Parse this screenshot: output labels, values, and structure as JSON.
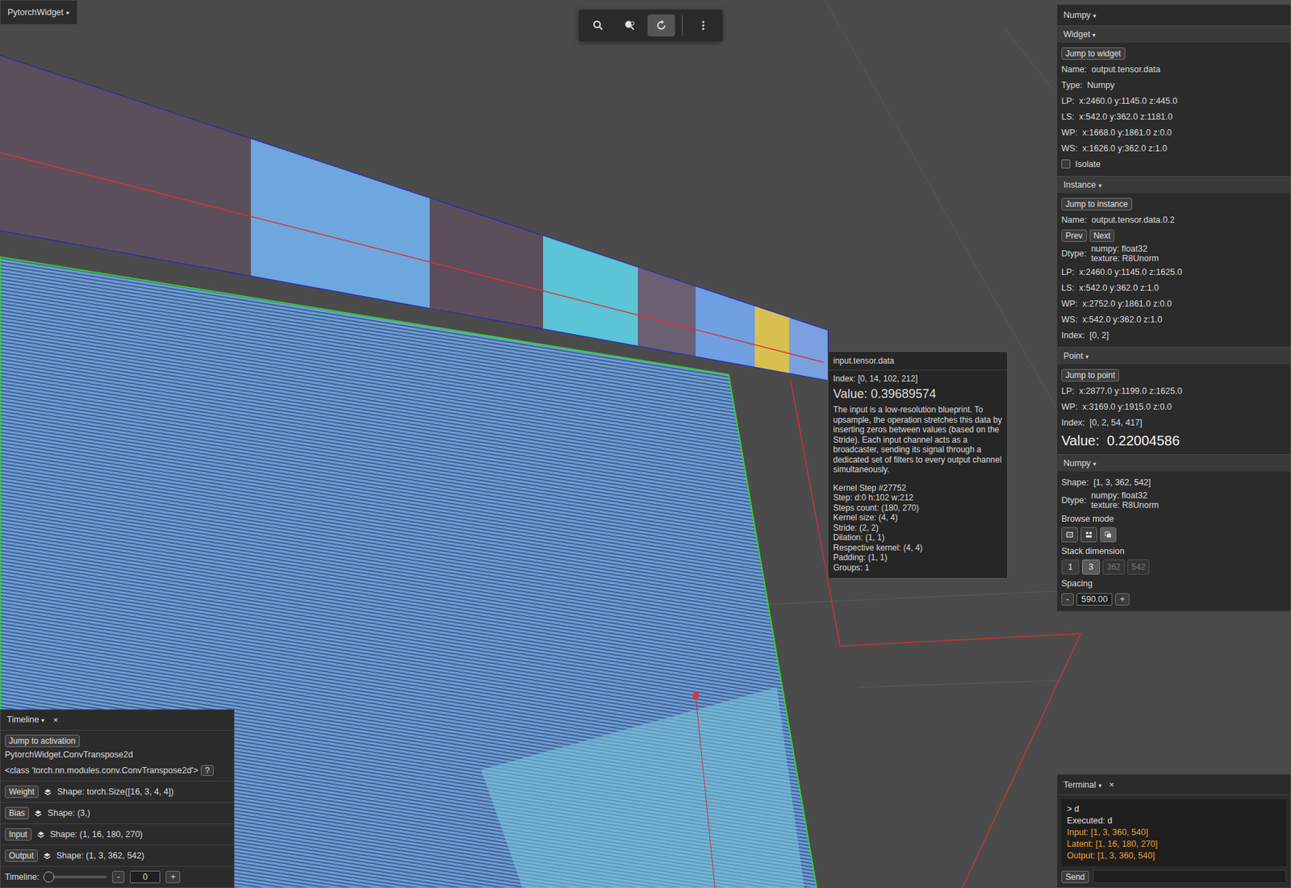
{
  "badge": {
    "label": "PytorchWidget",
    "caret": "▸"
  },
  "toolbar": {
    "tools": [
      {
        "kind": "search",
        "selected": false
      },
      {
        "kind": "zoom-pin",
        "selected": false
      },
      {
        "kind": "rotate",
        "selected": true
      },
      {
        "kind": "more",
        "selected": false
      }
    ]
  },
  "inspector": {
    "title": "Numpy",
    "caret": "▾",
    "widget": {
      "title": "Widget",
      "caret": "▾",
      "button": "Jump to widget",
      "fields": [
        {
          "label": "Name:",
          "value": [
            "output.tensor.data"
          ]
        },
        {
          "label": "Type:",
          "value": [
            "Numpy"
          ]
        },
        {
          "label": "LP:",
          "value": [
            "x:2460.0 y:1145.0 z:445.0"
          ]
        },
        {
          "label": "LS:",
          "value": [
            "x:542.0 y:362.0 z:1181.0"
          ]
        },
        {
          "label": "WP:",
          "value": [
            "x:1668.0 y:1861.0 z:0.0"
          ]
        },
        {
          "label": "WS:",
          "value": [
            "x:1626.0 y:362.0 z:1.0"
          ]
        }
      ],
      "isolate": {
        "label": "Isolate",
        "checked": false
      }
    },
    "instance": {
      "title": "Instance",
      "caret": "▾",
      "button": "Jump to instance",
      "name": {
        "label": "Name:",
        "value": [
          "output.tensor.data.0.2"
        ]
      },
      "nav": [
        "Prev",
        "Next"
      ],
      "fields": [
        {
          "label": "Dtype:",
          "value": [
            "numpy: float32",
            "texture: R8Unorm"
          ]
        },
        {
          "label": "LP:",
          "value": [
            "x:2460.0 y:1145.0 z:1625.0"
          ]
        },
        {
          "label": "LS:",
          "value": [
            "x:542.0 y:362.0 z:1.0"
          ]
        },
        {
          "label": "WP:",
          "value": [
            "x:2752.0 y:1861.0 z:0.0"
          ]
        },
        {
          "label": "WS:",
          "value": [
            "x:542.0 y:362.0 z:1.0"
          ]
        },
        {
          "label": "Index:",
          "value": [
            "[0, 2]"
          ]
        }
      ]
    },
    "point": {
      "title": "Point",
      "caret": "▾",
      "button": "Jump to point",
      "fields": [
        {
          "label": "LP:",
          "value": [
            "x:2877.0 y:1199.0 z:1625.0"
          ]
        },
        {
          "label": "WP:",
          "value": [
            "x:3169.0 y:1915.0 z:0.0"
          ]
        },
        {
          "label": "Index:",
          "value": [
            "[0, 2, 54, 417]"
          ]
        }
      ],
      "value": {
        "label": "Value:",
        "value": "0.22004586"
      }
    },
    "numpy": {
      "title": "Numpy",
      "caret": "▾",
      "fields": [
        {
          "label": "Shape:",
          "value": [
            "[1, 3, 362, 542]"
          ]
        },
        {
          "label": "Dtype:",
          "value": [
            "numpy: float32",
            "texture: R8Unorm"
          ]
        }
      ],
      "browse": {
        "label": "Browse mode",
        "modes": [
          {
            "kind": "list",
            "selected": false
          },
          {
            "kind": "grid",
            "selected": false
          },
          {
            "kind": "stack",
            "selected": true
          }
        ]
      },
      "stack": {
        "label": "Stack dimension",
        "options": [
          {
            "label": "1",
            "selected": false,
            "disabled": false
          },
          {
            "label": "3",
            "selected": true,
            "disabled": false
          },
          {
            "label": "362",
            "selected": false,
            "disabled": true
          },
          {
            "label": "542",
            "selected": false,
            "disabled": true
          }
        ]
      },
      "spacing": {
        "label": "Spacing",
        "minus": "-",
        "value": "590.00",
        "plus": "+"
      }
    }
  },
  "tooltip": {
    "title": "input.tensor.data",
    "index": "Index: [0, 14, 102, 212]",
    "value": "Value: 0.39689574",
    "description": "The input is a low-resolution blueprint. To upsample, the operation stretches this data by inserting zeros between values (based on the Stride). Each input channel acts as a broadcaster, sending its signal through a dedicated set of filters to every output channel simultaneously.",
    "details": [
      "Kernel Step #27752",
      "Step: d:0 h:102 w:212",
      "Steps count: (180, 270)",
      "Kernel size: (4, 4)",
      "Stride: (2, 2)",
      "Dilation: (1, 1)",
      "Respective kernel: (4, 4)",
      "Padding: (1, 1)",
      "Groups: 1"
    ]
  },
  "timeline": {
    "title": "Timeline",
    "caret": "▾",
    "close": "×",
    "button": "Jump to activation",
    "module": "PytorchWidget.ConvTranspose2d",
    "class": "<class 'torch.nn.modules.conv.ConvTranspose2d'>",
    "help": "?",
    "params": [
      {
        "label": "Weight",
        "shape": "Shape: torch.Size([16, 3, 4, 4])"
      },
      {
        "label": "Bias",
        "shape": "Shape: (3,)"
      },
      {
        "label": "Input",
        "shape": "Shape: (1, 16, 180, 270)"
      },
      {
        "label": "Output",
        "shape": "Shape: (1, 3, 362, 542)"
      }
    ],
    "slider": {
      "label": "Timeline:",
      "level": 0,
      "minus": "-",
      "value": "0",
      "plus": "+"
    }
  },
  "terminal": {
    "title": "Terminal",
    "caret": "▾",
    "close": "×",
    "lines": [
      {
        "text": "> d",
        "color": "#e0e0e0"
      },
      {
        "text": "Executed: d",
        "color": "#e0e0e0"
      },
      {
        "text": "Input: [1, 3, 360, 540]",
        "color": "#f0a030"
      },
      {
        "text": "Latent: [1, 16, 180, 270]",
        "color": "#f0a030"
      },
      {
        "text": "Output: [1, 3, 360, 540]",
        "color": "#f0a030"
      }
    ],
    "send": "Send",
    "input": ""
  }
}
